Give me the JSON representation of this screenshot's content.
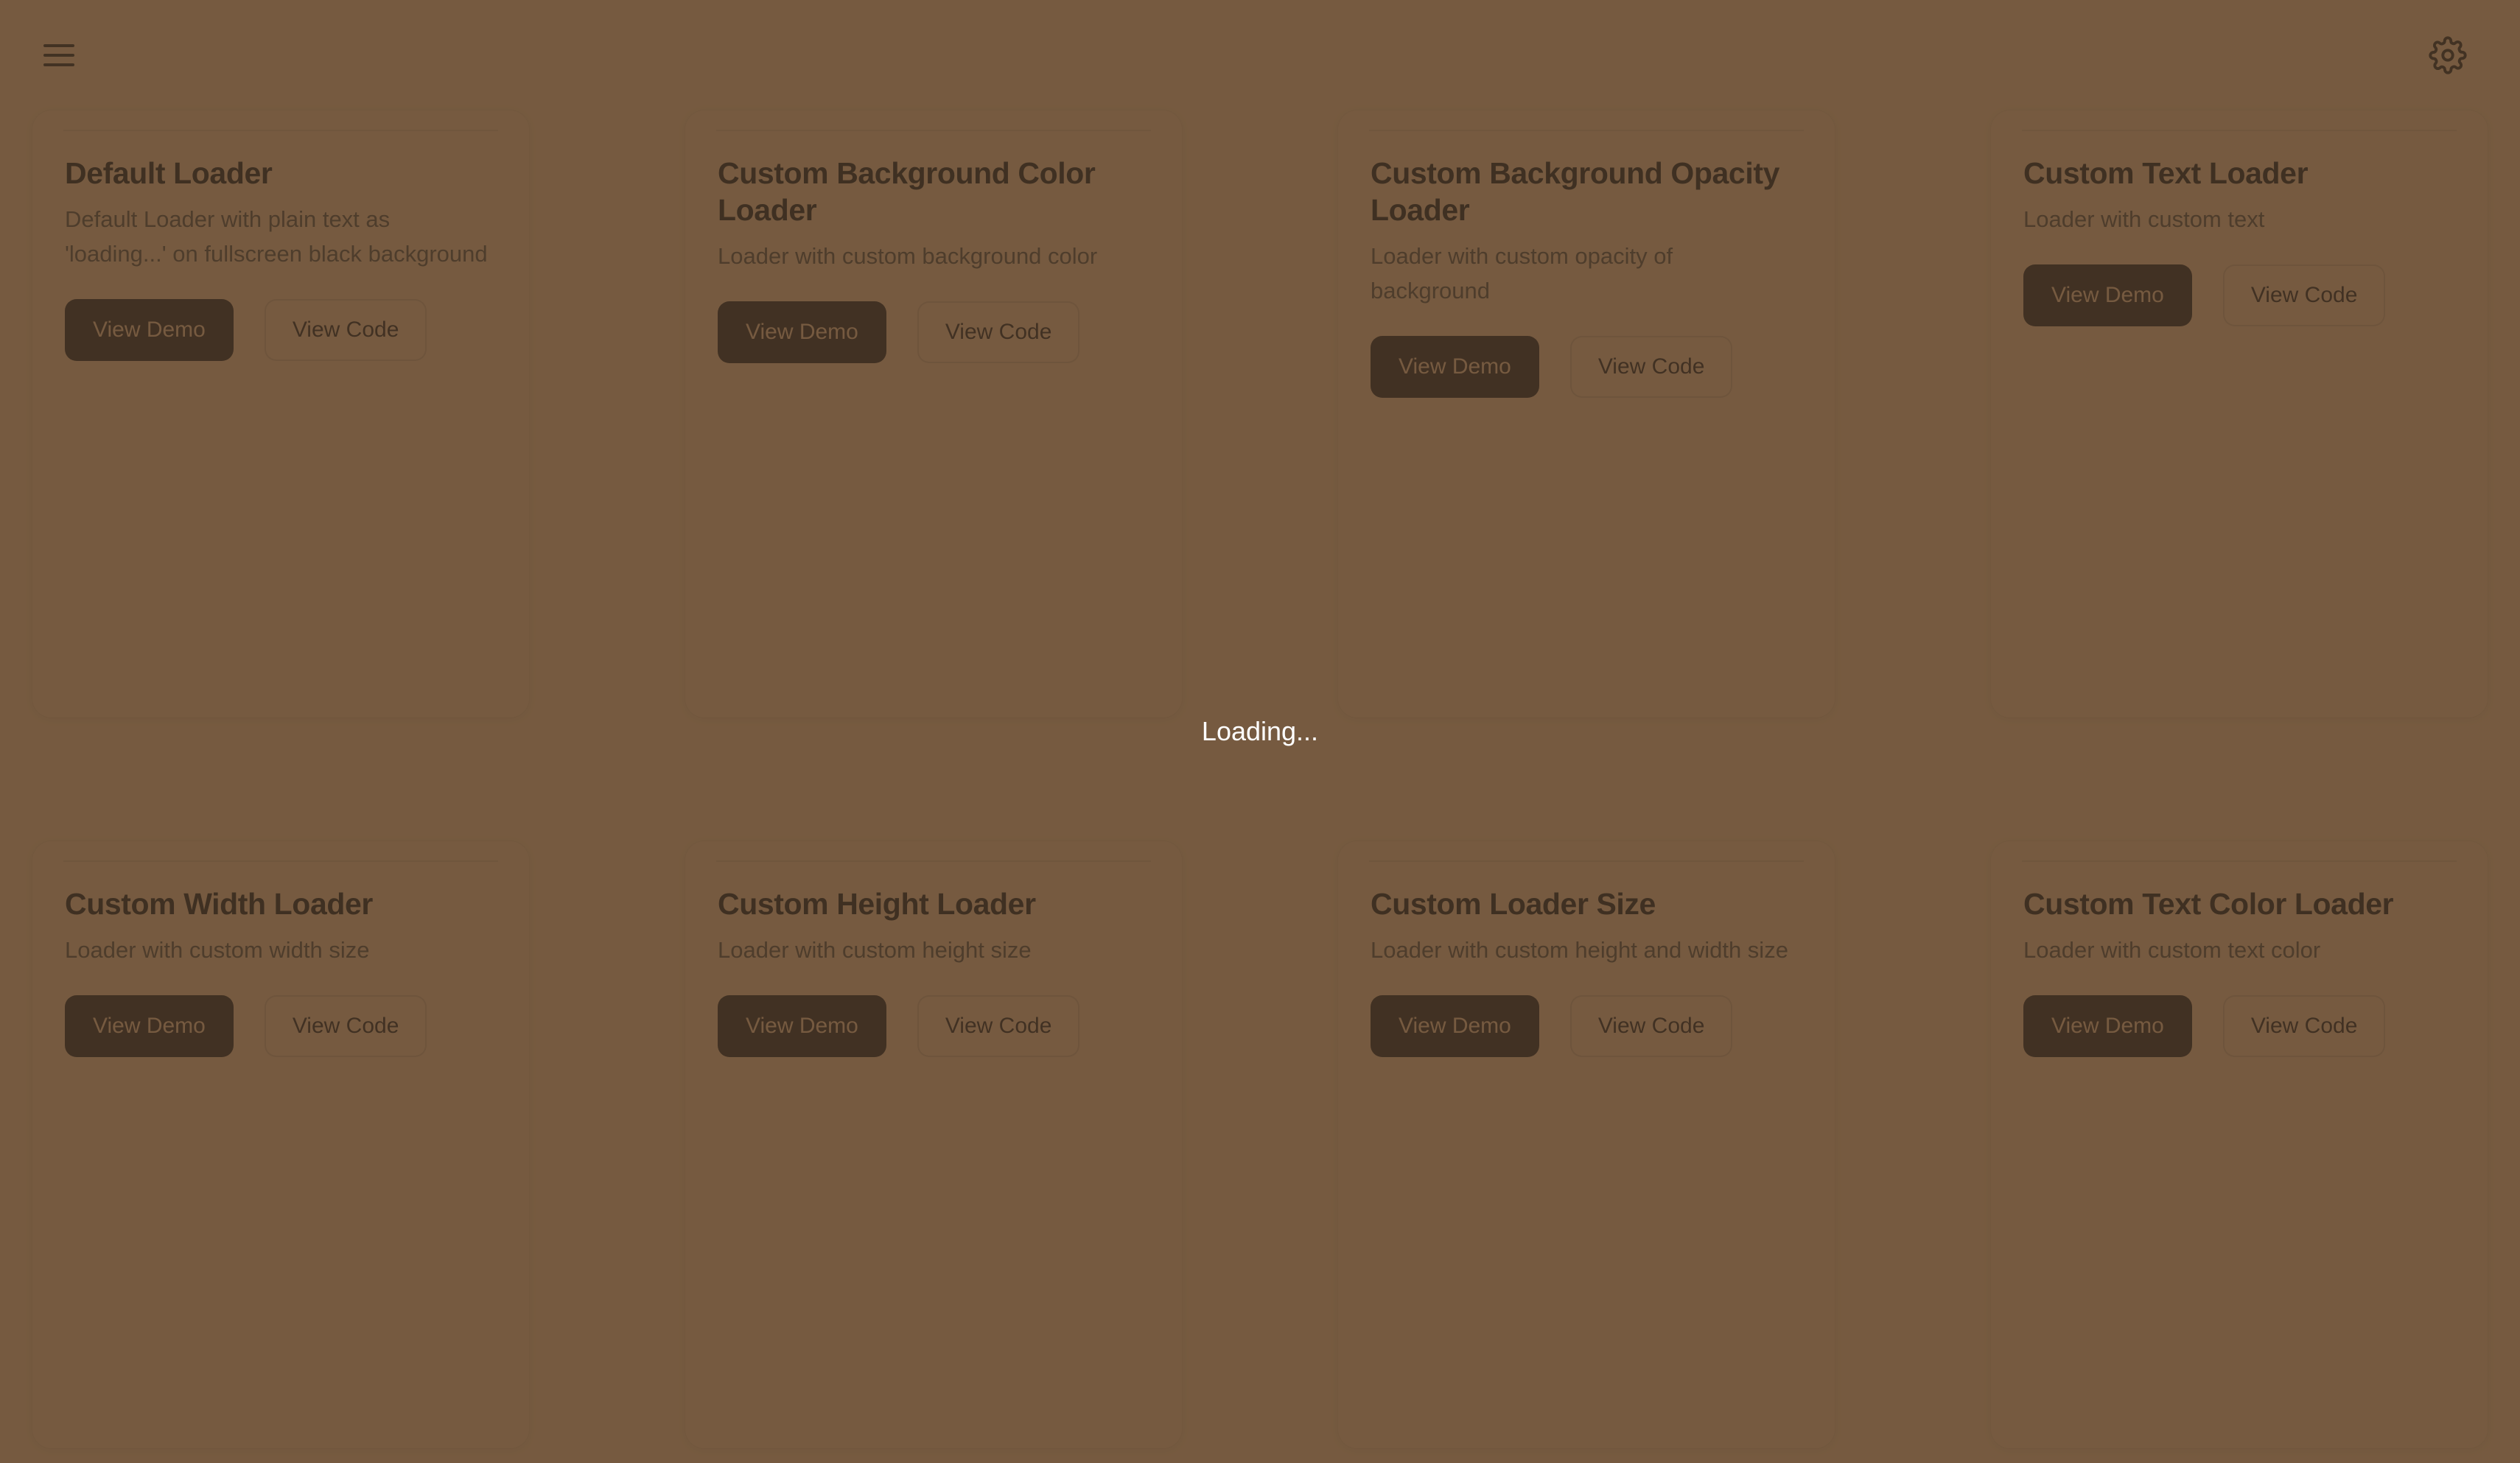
{
  "header": {
    "menu_icon": "hamburger-menu-icon",
    "settings_icon": "gear-icon"
  },
  "buttons": {
    "view_demo": "View Demo",
    "view_code": "View Code"
  },
  "overlay": {
    "text": "Loading...",
    "text_color": "#ffffff",
    "backdrop_color": "#000000"
  },
  "colors": {
    "page_background": "#ffffff",
    "card_background": "#ffffff",
    "title_text": "#111214",
    "description_text": "#545861",
    "primary_button_bg": "#18181b",
    "primary_button_text": "#ffffff",
    "secondary_button_bg": "#ffffff",
    "secondary_button_text": "#18181b",
    "tint_overlay": "#a88059"
  },
  "cards": [
    {
      "title": "Default Loader",
      "description": "Default Loader with plain text as 'loading...' on fullscreen black background"
    },
    {
      "title": "Custom Background Color Loader",
      "description": "Loader with custom background color"
    },
    {
      "title": "Custom Background Opacity Loader",
      "description": "Loader with custom opacity of background"
    },
    {
      "title": "Custom Text Loader",
      "description": "Loader with custom text"
    },
    {
      "title": "Custom Width Loader",
      "description": "Loader with custom width size"
    },
    {
      "title": "Custom Height Loader",
      "description": "Loader with custom height size"
    },
    {
      "title": "Custom Loader Size",
      "description": "Loader with custom height and width size"
    },
    {
      "title": "Custom Text Color Loader",
      "description": "Loader with custom text color"
    }
  ]
}
